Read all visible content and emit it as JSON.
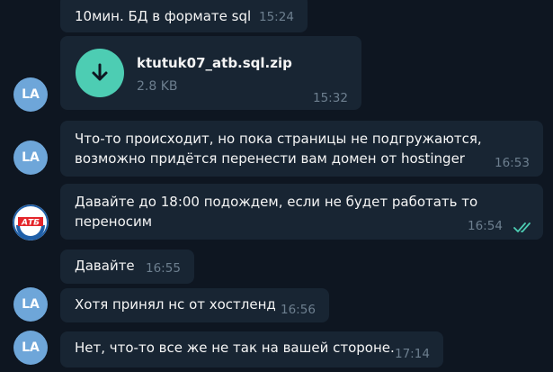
{
  "messages": [
    {
      "text": "10мин. БД в формате sql",
      "time": "15:24"
    },
    {
      "file_name": "ktutuk07_atb.sql.zip",
      "file_size": "2.8 KB",
      "time": "15:32",
      "avatar": "LA",
      "icon": "download-arrow-icon"
    },
    {
      "lines": [
        "Что-то происходит, но пока страницы не подгружаются,",
        "возможно придётся перенести вам домен от hostinger"
      ],
      "time": "16:53",
      "avatar": "LA"
    },
    {
      "lines": [
        "Давайте до 18:00 подождем, если не будет работать то",
        "переносим"
      ],
      "time": "16:54",
      "status": "read-double-check-icon"
    },
    {
      "text": "Давайте",
      "time": "16:55"
    },
    {
      "text": "Хотя принял нс от хостленд",
      "time": "16:56",
      "avatar": "LA"
    },
    {
      "text": "Нет, что-то все же не так на вашей стороне.",
      "time": "17:14",
      "avatar": "LA"
    }
  ],
  "logo": {
    "text": "АТБ",
    "colors": {
      "red": "#e4262b",
      "blue": "#1f5fa8"
    }
  },
  "colors": {
    "background": "#0e1621",
    "bubble": "#182533",
    "avatar": "#6ea6d9",
    "file_icon": "#4dcdb3",
    "check": "#4dcdb3"
  }
}
